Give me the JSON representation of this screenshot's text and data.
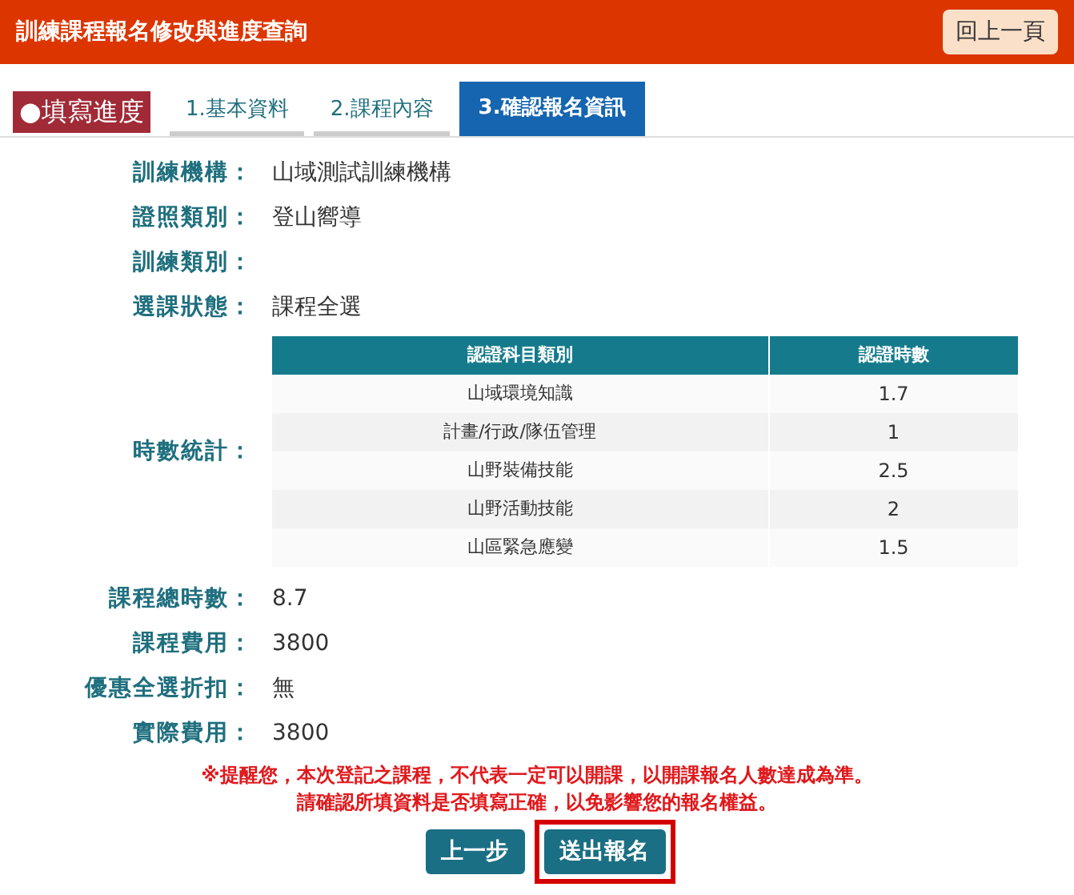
{
  "header": {
    "title": "訓練課程報名修改與進度查詢",
    "back_button": "回上一頁"
  },
  "progress_label": "●填寫進度",
  "tabs": [
    {
      "label": "1.基本資料",
      "selected": false
    },
    {
      "label": "2.課程內容",
      "selected": false
    },
    {
      "label": "3.確認報名資訊",
      "selected": true
    }
  ],
  "info_top": [
    {
      "label": "訓練機構：",
      "value": "山域測試訓練機構"
    },
    {
      "label": "證照類別：",
      "value": "登山嚮導"
    },
    {
      "label": "訓練類別："
    },
    {
      "label": "選課狀態：",
      "value": "課程全選"
    }
  ],
  "hours": {
    "label": "時數統計：",
    "columns": [
      "認證科目類別",
      "認證時數"
    ],
    "rows": [
      [
        "山域環境知識",
        "1.7"
      ],
      [
        "計畫/行政/隊伍管理",
        "1"
      ],
      [
        "山野裝備技能",
        "2.5"
      ],
      [
        "山野活動技能",
        "2"
      ],
      [
        "山區緊急應變",
        "1.5"
      ]
    ]
  },
  "info_bottom": [
    {
      "label": "課程總時數：",
      "value": "8.7"
    },
    {
      "label": "課程費用：",
      "value": "3800"
    },
    {
      "label": "優惠全選折扣：",
      "value": "無"
    },
    {
      "label": "實際費用：",
      "value": "3800"
    }
  ],
  "notice": [
    "※提醒您，本次登記之課程，不代表一定可以開課，以開課報名人數達成為準。",
    "請確認所填資料是否填寫正確，以免影響您的報名權益。"
  ],
  "buttons": [
    {
      "label": "上一步",
      "highlighted": false
    },
    {
      "label": "送出報名",
      "highlighted": true
    }
  ]
}
